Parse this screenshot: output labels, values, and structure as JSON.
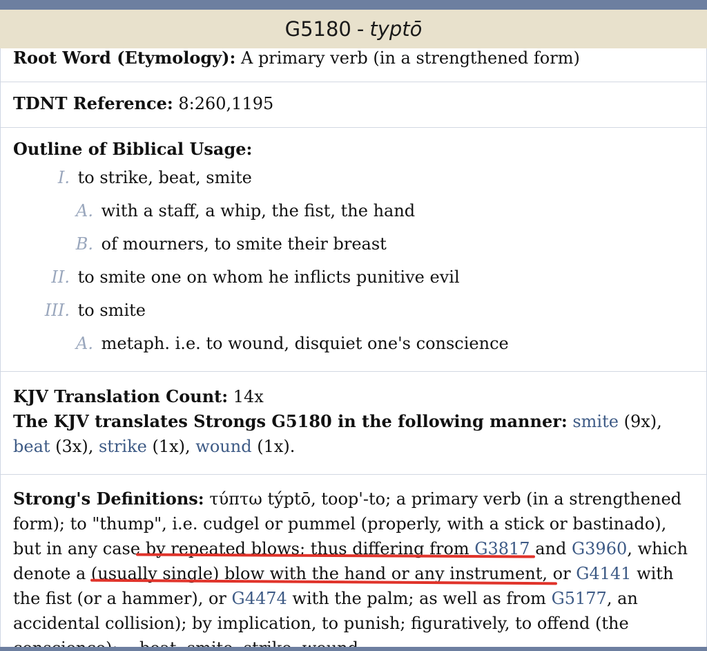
{
  "header": {
    "code": "G5180",
    "separator": "-",
    "transliteration": "typtō"
  },
  "root_word": {
    "label": "Root Word (Etymology):",
    "text": "A primary verb (in a strengthened form)"
  },
  "tdnt": {
    "label": "TDNT Reference:",
    "text": "8:260,1195"
  },
  "outline": {
    "label": "Outline of Biblical Usage:",
    "items": [
      {
        "num": "I.",
        "text": "to strike, beat, smite"
      },
      {
        "num": "A.",
        "text": "with a staff, a whip, the fist, the hand"
      },
      {
        "num": "B.",
        "text": "of mourners, to smite their breast"
      },
      {
        "num": "II.",
        "text": "to smite one on whom he inflicts punitive evil"
      },
      {
        "num": "III.",
        "text": "to smite"
      },
      {
        "num": "A.",
        "text": "metaph. i.e. to wound, disquiet one's conscience"
      }
    ]
  },
  "kjv": {
    "count_label": "KJV Translation Count:",
    "count_value": "14x",
    "translates_label": "The KJV translates Strongs G5180 in the following manner:",
    "renderings": [
      {
        "word": "smite",
        "count": "(9x)",
        "sep": ","
      },
      {
        "word": "beat",
        "count": "(3x)",
        "sep": ","
      },
      {
        "word": "strike",
        "count": "(1x)",
        "sep": ","
      },
      {
        "word": "wound",
        "count": "(1x)",
        "sep": "."
      }
    ]
  },
  "strongs": {
    "label": "Strong's Definitions:",
    "greek": "τύπτω",
    "t1": "týptō, toop'-to; a primary verb (in a strengthened form); to \"thump\", i.e. cudgel or pummel (properly, with a stick or bastinado), but in any case by repeated blows; thus differing from",
    "link1": "G3817",
    "t2": "and",
    "link2": "G3960",
    "t3": ", which denote a (usually single) blow with the hand or any instrument, or",
    "link3": "G4141",
    "t4": "with the fist (or a hammer), or",
    "link4": "G4474",
    "t5": "with the palm; as well as from",
    "link5": "G5177",
    "t6": ", an accidental collision); by implication, to punish; figuratively, to offend (the conscience): -- beat, smite, strike, wound."
  },
  "colors": {
    "link": "#3d5a85",
    "header_bg": "#e8e1cc",
    "topbar": "#6d7fa0",
    "annotation": "#e0332a",
    "numeral": "#9aa7bd"
  }
}
